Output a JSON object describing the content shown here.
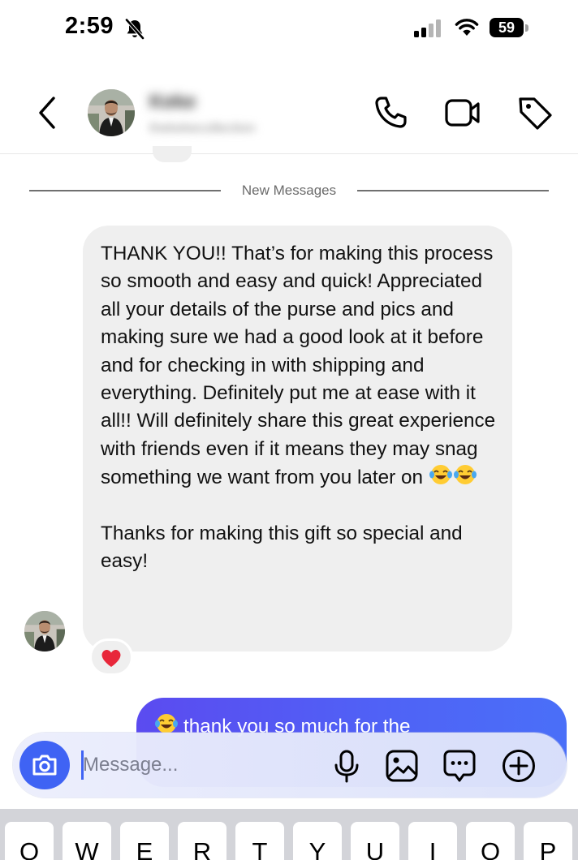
{
  "status_bar": {
    "time": "2:59",
    "battery": "59",
    "icons": [
      "bell-slash-icon",
      "cellular-signal-icon",
      "wifi-icon",
      "battery-icon"
    ]
  },
  "header": {
    "contact_name": "Keke",
    "contact_subtitle": "thekekecollection",
    "icons": [
      "chevron-left-icon",
      "phone-icon",
      "video-camera-icon",
      "tag-icon"
    ]
  },
  "divider": {
    "label": "New Messages"
  },
  "incoming_message": {
    "text_part1": "THANK YOU!! That’s for making this process so smooth and easy and quick! Appreciated all your details of the purse and pics and making sure we had a good look at it before and for checking in with shipping and everything. Definitely put me at ease with it all!! Will definitely share this great experience with friends even if it means they may snag something we want from you later on ",
    "text_part2": "Thanks for making this gift so special and easy!",
    "emoji_icons": [
      "face-with-tears-of-joy-icon",
      "face-with-tears-of-joy-icon"
    ],
    "reaction": "❤️"
  },
  "outgoing_message": {
    "text": "thank you so much for the",
    "emoji_icon": "face-with-tears-of-joy-icon"
  },
  "composer": {
    "placeholder": "Message...",
    "icons": [
      "camera-icon",
      "microphone-icon",
      "gallery-icon",
      "chat-bubble-icon",
      "plus-circle-icon"
    ]
  },
  "keyboard": {
    "keys": [
      "Q",
      "W",
      "E",
      "R",
      "T",
      "Y",
      "U",
      "I",
      "O",
      "P"
    ]
  },
  "colors": {
    "accent": "#3f63f4",
    "bubble_incoming": "#efefef",
    "bubble_outgoing_start": "#5b4bf0",
    "bubble_outgoing_end": "#4a6ff8",
    "keyboard_bg": "#d3d4d9"
  }
}
